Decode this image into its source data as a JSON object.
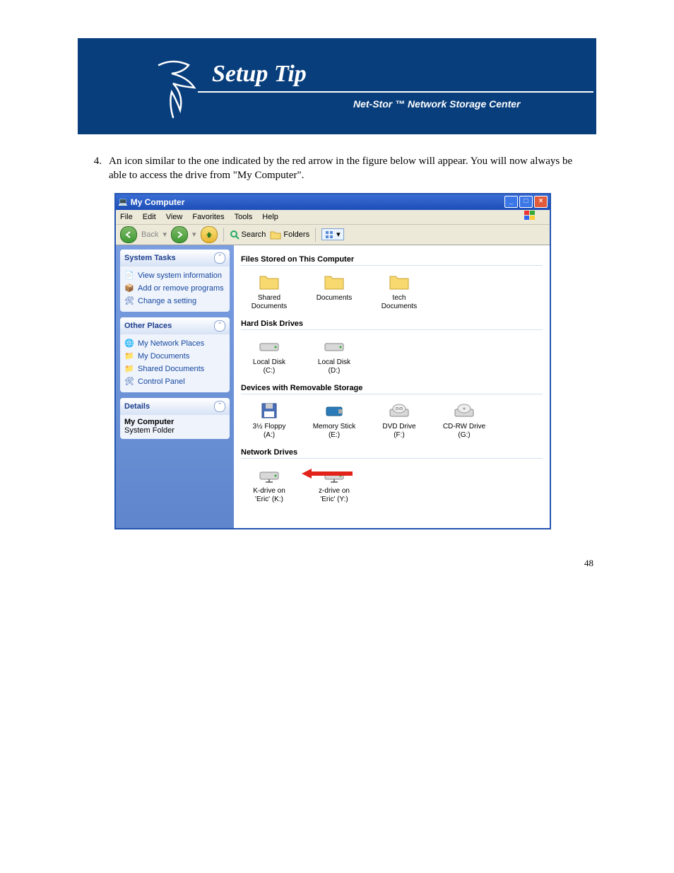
{
  "banner": {
    "title": "Setup Tip",
    "subtitle": "Net-Stor ™ Network Storage Center"
  },
  "step": {
    "num": "4.",
    "text": "An icon similar to the one indicated by the red arrow in the figure below will appear.  You will now always be able to access the drive from \"My Computer\"."
  },
  "window": {
    "title": "My Computer",
    "menu": [
      "File",
      "Edit",
      "View",
      "Favorites",
      "Tools",
      "Help"
    ],
    "toolbar": {
      "back": "Back",
      "search": "Search",
      "folders": "Folders"
    },
    "sidebar": {
      "tasks": {
        "hd": "System Tasks",
        "items": [
          "View system information",
          "Add or remove programs",
          "Change a setting"
        ]
      },
      "places": {
        "hd": "Other Places",
        "items": [
          "My Network Places",
          "My Documents",
          "Shared Documents",
          "Control Panel"
        ]
      },
      "details": {
        "hd": "Details",
        "name": "My Computer",
        "type": "System Folder"
      }
    },
    "sections": {
      "files": {
        "hd": "Files Stored on This Computer",
        "items": [
          "Shared Documents",
          "Documents",
          "tech Documents"
        ]
      },
      "hdd": {
        "hd": "Hard Disk Drives",
        "items": [
          "Local Disk (C:)",
          "Local Disk (D:)"
        ]
      },
      "rem": {
        "hd": "Devices with Removable Storage",
        "items": [
          "3½ Floppy (A:)",
          "Memory Stick (E:)",
          "DVD Drive (F:)",
          "CD-RW Drive (G:)"
        ]
      },
      "net": {
        "hd": "Network Drives",
        "items": [
          "K-drive on 'Eric' (K:)",
          "z-drive on 'Eric' (Y:)"
        ]
      }
    }
  },
  "page_number": "48"
}
